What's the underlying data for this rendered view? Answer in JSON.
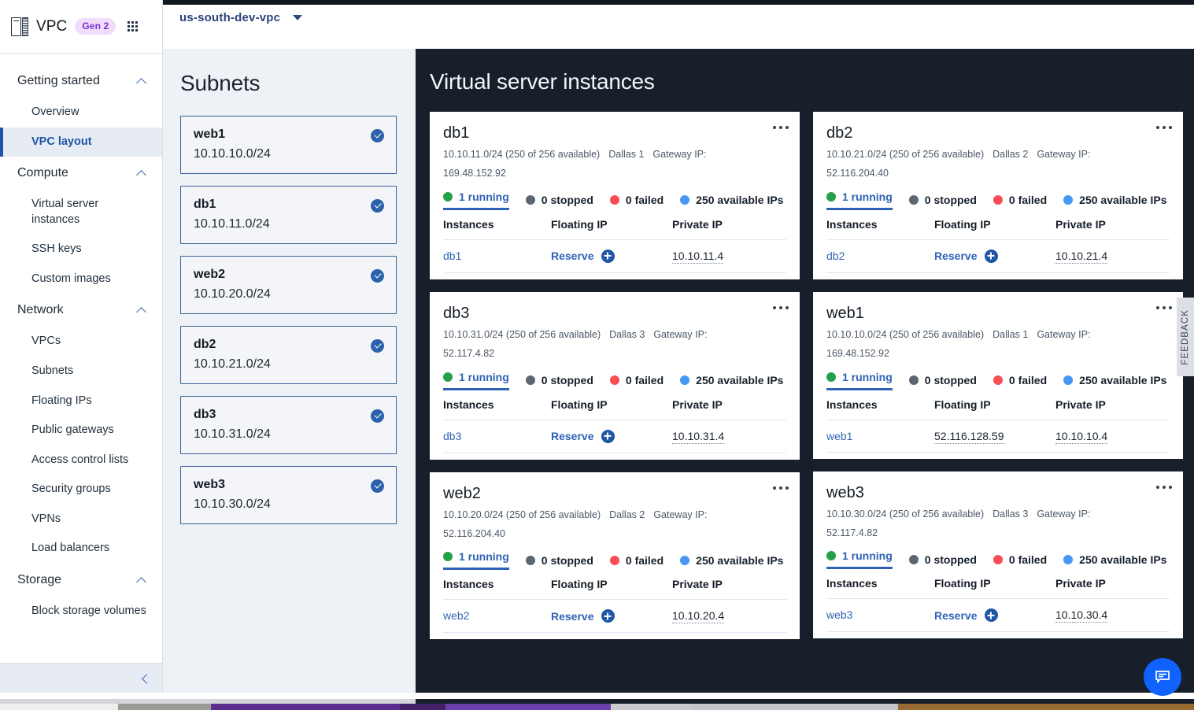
{
  "brand": {
    "product_icon": "vpc-server-icon",
    "name": "VPC",
    "badge": "Gen 2",
    "app_switcher_icon": "app-grid-icon"
  },
  "header": {
    "vpc_selector_value": "us-south-dev-vpc",
    "caret_icon": "chevron-down-icon"
  },
  "sidebar": {
    "groups": [
      {
        "label": "Getting started",
        "chevron_icon": "chevron-up-icon",
        "items": [
          {
            "label": "Overview",
            "active": false
          },
          {
            "label": "VPC layout",
            "active": true
          }
        ]
      },
      {
        "label": "Compute",
        "chevron_icon": "chevron-up-icon",
        "items": [
          {
            "label": "Virtual server instances",
            "active": false
          },
          {
            "label": "SSH keys",
            "active": false
          },
          {
            "label": "Custom images",
            "active": false
          }
        ]
      },
      {
        "label": "Network",
        "chevron_icon": "chevron-up-icon",
        "items": [
          {
            "label": "VPCs",
            "active": false
          },
          {
            "label": "Subnets",
            "active": false
          },
          {
            "label": "Floating IPs",
            "active": false
          },
          {
            "label": "Public gateways",
            "active": false
          },
          {
            "label": "Access control lists",
            "active": false
          },
          {
            "label": "Security groups",
            "active": false
          },
          {
            "label": "VPNs",
            "active": false
          },
          {
            "label": "Load balancers",
            "active": false
          }
        ]
      },
      {
        "label": "Storage",
        "chevron_icon": "chevron-up-icon",
        "items": [
          {
            "label": "Block storage volumes",
            "active": false
          }
        ]
      }
    ],
    "collapse_icon": "chevron-left-icon"
  },
  "subnets_panel": {
    "title": "Subnets",
    "cards": [
      {
        "name": "web1",
        "cidr": "10.10.10.0/24",
        "status_icon": "check-circle-icon"
      },
      {
        "name": "db1",
        "cidr": "10.10.11.0/24",
        "status_icon": "check-circle-icon"
      },
      {
        "name": "web2",
        "cidr": "10.10.20.0/24",
        "status_icon": "check-circle-icon"
      },
      {
        "name": "db2",
        "cidr": "10.10.21.0/24",
        "status_icon": "check-circle-icon"
      },
      {
        "name": "db3",
        "cidr": "10.10.31.0/24",
        "status_icon": "check-circle-icon"
      },
      {
        "name": "web3",
        "cidr": "10.10.30.0/24",
        "status_icon": "check-circle-icon"
      }
    ]
  },
  "instances_panel": {
    "title": "Virtual server instances",
    "table_headers": {
      "instances": "Instances",
      "floating_ip": "Floating IP",
      "private_ip": "Private IP"
    },
    "reserve_label": "Reserve",
    "reserve_icon": "plus-circle-icon",
    "overflow_icon": "overflow-menu-icon",
    "status_colors": {
      "running": "#24a148",
      "stopped": "#5b6670",
      "failed": "#fa4d56",
      "available": "#4596f5"
    },
    "cards": [
      {
        "name": "db1",
        "cidr": "10.10.11.0/24 (250 of 256 available)",
        "zone": "Dallas 1",
        "gateway_label": "Gateway IP:",
        "gateway_ip": "169.48.152.92",
        "gateway_wraps": true,
        "stats": [
          {
            "label": "1 running",
            "selected": true
          },
          {
            "label": "0 stopped",
            "selected": false
          },
          {
            "label": "0 failed",
            "selected": false
          },
          {
            "label": "250 available IPs",
            "selected": false
          }
        ],
        "rows": [
          {
            "instance": "db1",
            "floating_ip": "Reserve",
            "floating_is_reserve": true,
            "private_ip": "10.10.11.4"
          }
        ]
      },
      {
        "name": "db3",
        "cidr": "10.10.31.0/24 (250 of 256 available)",
        "zone": "Dallas 3",
        "gateway_label": "Gateway IP: 52.117.4.82",
        "gateway_ip": "",
        "gateway_wraps": false,
        "stats": [
          {
            "label": "1 running",
            "selected": true
          },
          {
            "label": "0 stopped",
            "selected": false
          },
          {
            "label": "0 failed",
            "selected": false
          },
          {
            "label": "250 available IPs",
            "selected": false
          }
        ],
        "rows": [
          {
            "instance": "db3",
            "floating_ip": "Reserve",
            "floating_is_reserve": true,
            "private_ip": "10.10.31.4"
          }
        ]
      },
      {
        "name": "web2",
        "cidr": "10.10.20.0/24 (250 of 256 available)",
        "zone": "Dallas 2",
        "gateway_label": "Gateway IP:",
        "gateway_ip": "52.116.204.40",
        "gateway_wraps": true,
        "stats": [
          {
            "label": "1 running",
            "selected": true
          },
          {
            "label": "0 stopped",
            "selected": false
          },
          {
            "label": "0 failed",
            "selected": false
          },
          {
            "label": "250 available IPs",
            "selected": false
          }
        ],
        "rows": [
          {
            "instance": "web2",
            "floating_ip": "Reserve",
            "floating_is_reserve": true,
            "private_ip": "10.10.20.4"
          }
        ]
      },
      {
        "name": "db2",
        "cidr": "10.10.21.0/24 (250 of 256 available)",
        "zone": "Dallas 2",
        "gateway_label": "Gateway IP:",
        "gateway_ip": "52.116.204.40",
        "gateway_wraps": true,
        "stats": [
          {
            "label": "1 running",
            "selected": true
          },
          {
            "label": "0 stopped",
            "selected": false
          },
          {
            "label": "0 failed",
            "selected": false
          },
          {
            "label": "250 available IPs",
            "selected": false
          }
        ],
        "rows": [
          {
            "instance": "db2",
            "floating_ip": "Reserve",
            "floating_is_reserve": true,
            "private_ip": "10.10.21.4"
          }
        ]
      },
      {
        "name": "web1",
        "cidr": "10.10.10.0/24 (250 of 256 available)",
        "zone": "Dallas 1",
        "gateway_label": "Gateway IP:",
        "gateway_ip": "169.48.152.92",
        "gateway_wraps": true,
        "stats": [
          {
            "label": "1 running",
            "selected": true
          },
          {
            "label": "0 stopped",
            "selected": false
          },
          {
            "label": "0 failed",
            "selected": false
          },
          {
            "label": "250 available IPs",
            "selected": false
          }
        ],
        "rows": [
          {
            "instance": "web1",
            "floating_ip": "52.116.128.59",
            "floating_is_reserve": false,
            "private_ip": "10.10.10.4"
          }
        ]
      },
      {
        "name": "web3",
        "cidr": "10.10.30.0/24 (250 of 256 available)",
        "zone": "Dallas 3",
        "gateway_label": "Gateway IP: 52.117.4.82",
        "gateway_ip": "",
        "gateway_wraps": false,
        "stats": [
          {
            "label": "1 running",
            "selected": true
          },
          {
            "label": "0 stopped",
            "selected": false
          },
          {
            "label": "0 failed",
            "selected": false
          },
          {
            "label": "250 available IPs",
            "selected": false
          }
        ],
        "rows": [
          {
            "instance": "web3",
            "floating_ip": "Reserve",
            "floating_is_reserve": true,
            "private_ip": "10.10.30.4"
          }
        ]
      }
    ],
    "column_order": {
      "left": [
        0,
        1,
        2
      ],
      "right": [
        3,
        4,
        5
      ]
    }
  },
  "feedback_tab": {
    "label": "FEEDBACK"
  },
  "chat": {
    "icon": "chat-bubble-icon"
  }
}
